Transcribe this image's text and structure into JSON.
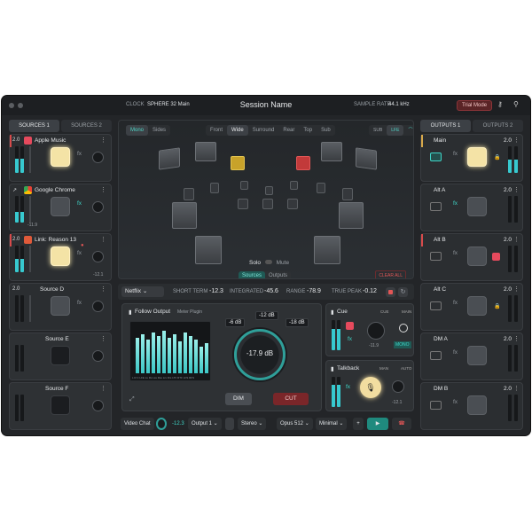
{
  "titlebar": {
    "clock_label": "CLOCK",
    "clock_value": "SPHERE 32 Main",
    "session": "Session Name",
    "rate_label": "SAMPLE RATE",
    "rate_value": "44.1 kHz",
    "trial": "Trial Mode"
  },
  "sources": {
    "tabs": [
      "SOURCES 1",
      "SOURCES 2"
    ],
    "strips": [
      {
        "ch": "2.0",
        "name": "Apple Music",
        "fx": "fx",
        "val": ""
      },
      {
        "ch": "",
        "name": "Google Chrome",
        "fx": "fx",
        "val": "-11.9"
      },
      {
        "ch": "2.0",
        "name": "Link: Reason 13",
        "fx": "fx",
        "val": "-12.1"
      },
      {
        "ch": "2.0",
        "name": "Source D",
        "fx": "fx",
        "val": ""
      },
      {
        "ch": "",
        "name": "Source E",
        "fx": "",
        "val": ""
      },
      {
        "ch": "",
        "name": "Source F",
        "fx": "",
        "val": ""
      }
    ]
  },
  "outputs": {
    "tabs": [
      "OUTPUTS 1",
      "OUTPUTS 2"
    ],
    "strips": [
      {
        "name": "Main",
        "ch": "2.0",
        "fx": "fx"
      },
      {
        "name": "Alt A",
        "ch": "2.0",
        "fx": "fx"
      },
      {
        "name": "Alt B",
        "ch": "2.0",
        "fx": "fx"
      },
      {
        "name": "Alt C",
        "ch": "2.0",
        "fx": "fx"
      },
      {
        "name": "DM A",
        "ch": "2.0",
        "fx": "fx"
      },
      {
        "name": "DM B",
        "ch": "2.0",
        "fx": "fx"
      }
    ]
  },
  "room": {
    "mode_tabs": [
      "Mono",
      "Sides"
    ],
    "view_tabs": [
      "Front",
      "Wide",
      "Surround",
      "Rear",
      "Top",
      "Sub"
    ],
    "sub_tabs": [
      "SUB",
      "LFE"
    ],
    "solo": "Solo",
    "mute": "Mute",
    "src_out": [
      "Sources",
      "Outputs"
    ],
    "clear_all": "CLEAR ALL"
  },
  "loudness": {
    "source": "Netflix",
    "short_label": "SHORT TERM",
    "short_value": "-12.3",
    "int_label": "INTEGRATED",
    "int_value": "-45.6",
    "range_label": "RANGE",
    "range_value": "-78.9",
    "peak_label": "TRUE PEAK",
    "peak_value": "-0.12"
  },
  "follow": {
    "title": "Follow Output",
    "plugin": "Meter Plugin",
    "db1": "-6 dB",
    "db2": "-12 dB",
    "db3": "-18 dB",
    "knob": "-17.9 dB",
    "dim": "DIM",
    "cut": "CUT",
    "meter_labels": "L R C LFE Ls Rs Lss Rss Lrs Rrs LTF RTF LFS RFS"
  },
  "cue": {
    "title": "Cue",
    "cue_modes": [
      "CUE",
      "MAIN"
    ],
    "val": "-11.9",
    "mono": "MONO"
  },
  "talkback": {
    "title": "Talkback",
    "modes": [
      "MAN",
      "AUTO"
    ],
    "val": "-12.1",
    "fx": "fx"
  },
  "bottom": {
    "chat": "Video Chat",
    "chat_val": "-12.3",
    "output": "Output 1",
    "format": "Stereo",
    "codec": "Opus 512",
    "quality": "Minimal"
  }
}
